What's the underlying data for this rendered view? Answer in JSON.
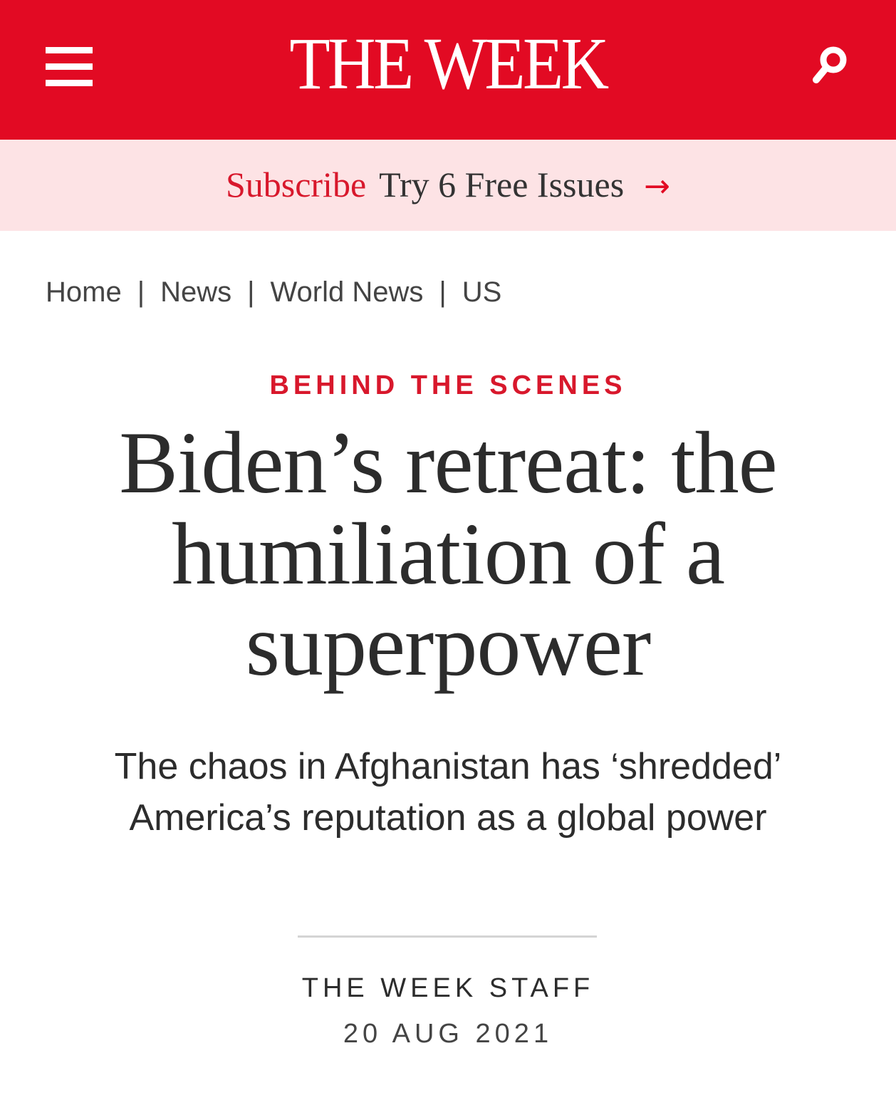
{
  "header": {
    "logo_text": "THE WEEK",
    "menu_icon": "hamburger-menu-icon",
    "search_icon": "search-icon",
    "bg_color": "#e20a23"
  },
  "subscribe": {
    "label": "Subscribe",
    "offer": "Try 6 Free Issues",
    "arrow": "→",
    "bg_color": "#fde3e5"
  },
  "breadcrumb": {
    "items": [
      "Home",
      "News",
      "World News",
      "US"
    ],
    "separator": "|"
  },
  "article": {
    "kicker": "BEHIND THE SCENES",
    "headline": "Biden’s retreat: the humiliation of a superpower",
    "standfirst": "The chaos in Afghanistan has ‘shredded’ America’s reputation as a global power",
    "author": "THE WEEK STAFF",
    "date": "20 AUG 2021",
    "accent_color": "#d8182c"
  }
}
